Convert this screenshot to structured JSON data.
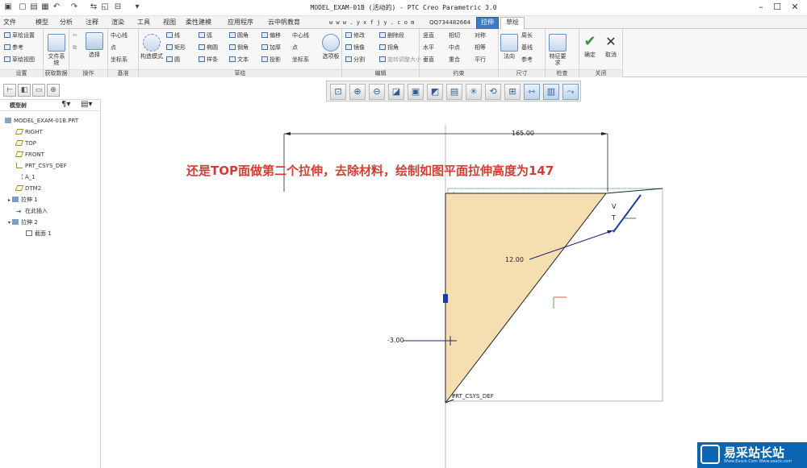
{
  "titlebar": {
    "title": "MODEL_EXAM-01B (活动的) - PTC Creo Parametric 3.0"
  },
  "tabs": [
    "文件",
    "模型",
    "分析",
    "注释",
    "渲染",
    "工具",
    "视图",
    "柔性建模",
    "应用程序",
    "云中帆教育",
    "w w w . y x f j y . c o m",
    "QQ734482664",
    "拉伸",
    "草绘"
  ],
  "ribbon": {
    "setup": {
      "label": "设置",
      "items": [
        "草绘设置",
        "参考",
        "草绘视图"
      ]
    },
    "get_data": {
      "label": "获取数据",
      "file_system": "文件系统"
    },
    "operations": {
      "label": "操作",
      "select": "选择"
    },
    "datum": {
      "label": "基准",
      "items": [
        "中心线",
        "点",
        "坐标系"
      ]
    },
    "sketch": {
      "label": "草绘",
      "palette": "构造模式",
      "items_col1": [
        "线",
        "矩形",
        "圆"
      ],
      "items_col2": [
        "弧",
        "椭圆",
        "样条"
      ],
      "items_col3": [
        "圆角",
        "倒角",
        "文本"
      ],
      "items_col4": [
        "偏移",
        "加厚",
        "投影"
      ],
      "items_col5": [
        "中心线",
        "点",
        "坐标系"
      ],
      "select_sketch": "选项板"
    },
    "editing": {
      "label": "编辑",
      "items": [
        "修改",
        "删除段",
        "镜像",
        "拐角",
        "分割",
        "旋转调整大小"
      ]
    },
    "constrain": {
      "label": "约束",
      "items": [
        "竖直",
        "相切",
        "对称",
        "水平",
        "中点",
        "相等",
        "垂直",
        "重合",
        "平行"
      ]
    },
    "dimension": {
      "label": "尺寸",
      "items": [
        "法向",
        "周长",
        "基线",
        "参考"
      ]
    },
    "inspect": {
      "label": "检查",
      "items": [
        "特征要求"
      ]
    },
    "close": {
      "label": "关闭",
      "ok": "确定",
      "cancel": "取消"
    }
  },
  "tree": {
    "header": "模型树",
    "nodes": [
      "MODEL_EXAM-01B.PRT",
      "RIGHT",
      "TOP",
      "FRONT",
      "PRT_CSYS_DEF",
      "A_1",
      "DTM2",
      "拉伸 1",
      "在此插入",
      "拉伸 2",
      "截面 1"
    ]
  },
  "canvas": {
    "annotation": "还是TOP面做第二个拉伸，去除材料，绘制如图平面拉伸高度为147",
    "dims": {
      "width": "165.00",
      "offset": "12.00",
      "left": "-3.00"
    },
    "csys_label": "PRT_CSYS_DEF",
    "constraint_v": "V",
    "constraint_t": "T"
  },
  "watermark": {
    "text": "易采站长站",
    "sub": "Www.Easck.Com  Www.easck.com"
  },
  "colors": {
    "fill": "#f5dfb0",
    "annotation": "#d43c34",
    "dim_line": "#1a237e",
    "accent": "#3d7bc2"
  }
}
